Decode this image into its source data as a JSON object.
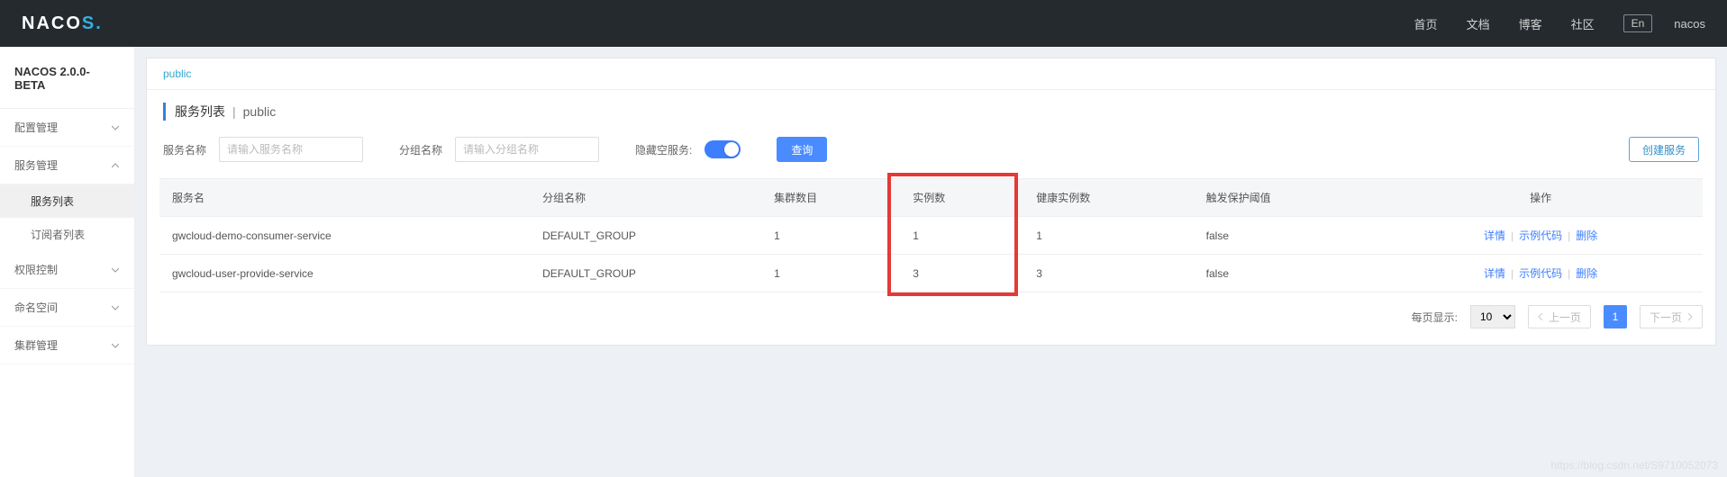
{
  "header": {
    "logo_text": "NACOS.",
    "nav": [
      "首页",
      "文档",
      "博客",
      "社区"
    ],
    "lang": "En",
    "user": "nacos"
  },
  "sidebar": {
    "version": "NACOS 2.0.0-BETA",
    "menu": [
      {
        "label": "配置管理",
        "expanded": false,
        "children": []
      },
      {
        "label": "服务管理",
        "expanded": true,
        "children": [
          {
            "label": "服务列表",
            "active": true
          },
          {
            "label": "订阅者列表",
            "active": false
          }
        ]
      },
      {
        "label": "权限控制",
        "expanded": false,
        "children": []
      },
      {
        "label": "命名空间",
        "expanded": false,
        "children": []
      },
      {
        "label": "集群管理",
        "expanded": false,
        "children": []
      }
    ]
  },
  "namespace": {
    "current": "public"
  },
  "page_title": {
    "text": "服务列表",
    "namespace": "public"
  },
  "filters": {
    "service_name": {
      "label": "服务名称",
      "placeholder": "请输入服务名称"
    },
    "group_name": {
      "label": "分组名称",
      "placeholder": "请输入分组名称"
    },
    "hide_empty": {
      "label": "隐藏空服务:",
      "on": true
    },
    "query_btn": "查询",
    "create_btn": "创建服务"
  },
  "table": {
    "columns": [
      "服务名",
      "分组名称",
      "集群数目",
      "实例数",
      "健康实例数",
      "触发保护阈值",
      "操作"
    ],
    "highlight_col_index": 3,
    "rows": [
      {
        "name": "gwcloud-demo-consumer-service",
        "group": "DEFAULT_GROUP",
        "cluster_count": "1",
        "instance_count": "1",
        "healthy_count": "1",
        "threshold": "false"
      },
      {
        "name": "gwcloud-user-provide-service",
        "group": "DEFAULT_GROUP",
        "cluster_count": "1",
        "instance_count": "3",
        "healthy_count": "3",
        "threshold": "false"
      }
    ],
    "ops": {
      "detail": "详情",
      "sample": "示例代码",
      "delete": "删除"
    }
  },
  "pager": {
    "page_size_label": "每页显示:",
    "page_size": "10",
    "prev": "上一页",
    "next": "下一页",
    "current": "1"
  },
  "watermark": "https://blog.csdn.net/S9710052073"
}
